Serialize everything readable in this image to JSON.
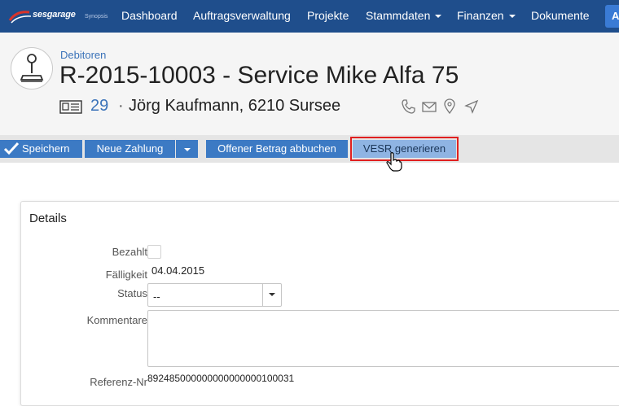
{
  "nav": {
    "logo_text": "sesgarage",
    "logo_sub": "Synopsis",
    "items": [
      {
        "label": "Dashboard",
        "dropdown": false
      },
      {
        "label": "Auftragsverwaltung",
        "dropdown": false
      },
      {
        "label": "Projekte",
        "dropdown": false
      },
      {
        "label": "Stammdaten",
        "dropdown": true
      },
      {
        "label": "Finanzen",
        "dropdown": true
      },
      {
        "label": "Dokumente",
        "dropdown": false
      }
    ],
    "right_button": "A"
  },
  "header": {
    "breadcrumb": "Debitoren",
    "title": "R-2015-10003 - Service Mike Alfa 75",
    "customer_number": "29",
    "separator": "·",
    "customer_name": "Jörg Kaufmann, 6210 Sursee",
    "contact_icons": [
      "phone-icon",
      "mail-icon",
      "map-pin-icon",
      "navigate-icon"
    ]
  },
  "toolbar": {
    "save_label": "Speichern",
    "new_payment_label": "Neue Zahlung",
    "write_off_label": "Offener Betrag abbuchen",
    "vesr_label": "VESR generieren"
  },
  "details": {
    "title": "Details",
    "paid_label": "Bezahlt",
    "paid_checked": false,
    "due_label": "Fälligkeit",
    "due_value": "04.04.2015",
    "status_label": "Status",
    "status_value": "--",
    "comment_label": "Kommentare",
    "comment_value": "",
    "reference_label": "Referenz-Nr",
    "reference_value": "892485000000000000000100031"
  },
  "colors": {
    "navbar": "#1f4e8c",
    "button": "#3c7ac4",
    "button_active": "#8fb4e3",
    "highlight": "#e02020",
    "link": "#3b73b9"
  }
}
